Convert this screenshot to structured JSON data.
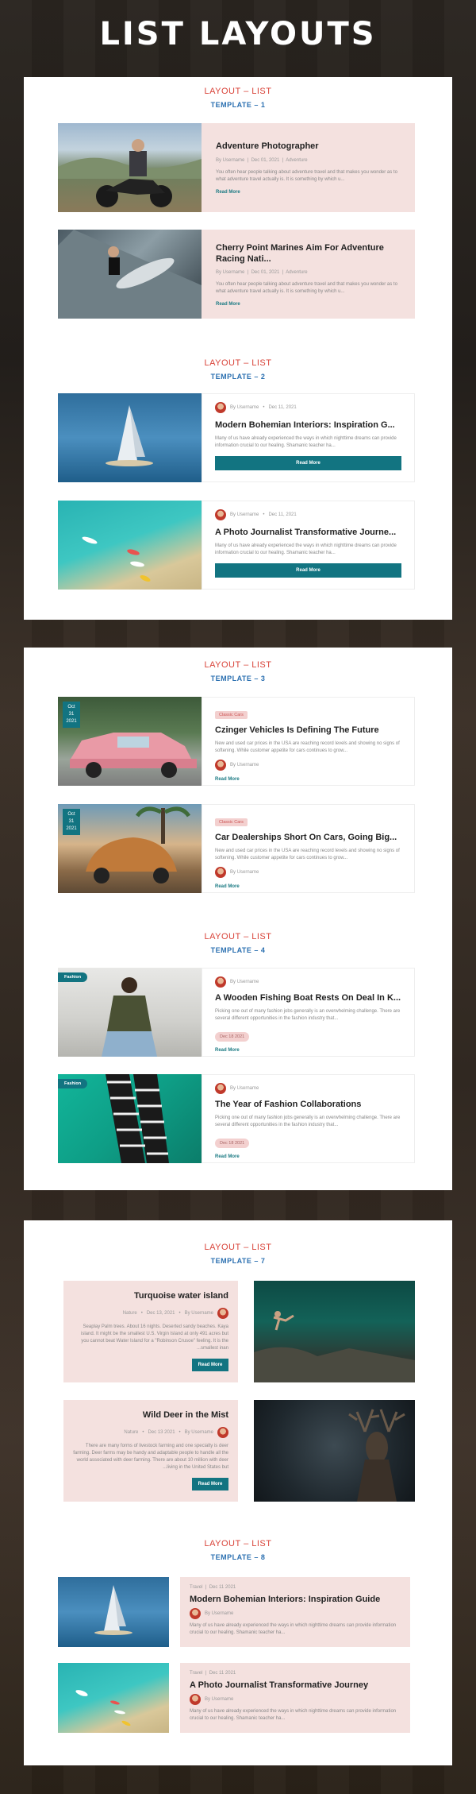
{
  "page_title": "LIST LAYOUTS",
  "sections": {
    "t1": {
      "layout": "LAYOUT – LIST",
      "template": "TEMPLATE – 1",
      "posts": [
        {
          "title": "Adventure Photographer",
          "author": "By Username",
          "date": "Dec 01, 2021",
          "category": "Adventure",
          "excerpt": "You often hear people talking about adventure travel and that makes you wonder as to what adventure travel actually is. It is something by which u...",
          "read_more": "Read More"
        },
        {
          "title": "Cherry Point Marines Aim For Adventure Racing Nati...",
          "author": "By Username",
          "date": "Dec 01, 2021",
          "category": "Adventure",
          "excerpt": "You often hear people talking about adventure travel and that makes you wonder as to what adventure travel actually is. It is something by which u...",
          "read_more": "Read More"
        }
      ]
    },
    "t2": {
      "layout": "LAYOUT – LIST",
      "template": "TEMPLATE – 2",
      "posts": [
        {
          "author": "By Username",
          "date": "Dec 11, 2021",
          "title": "Modern Bohemian Interiors: Inspiration G...",
          "excerpt": "Many of us have already experienced the ways in which nighttime dreams can provide information crucial to our healing. Shamanic teacher ha...",
          "button": "Read More"
        },
        {
          "author": "By Username",
          "date": "Dec 11, 2021",
          "title": "A Photo Journalist Transformative Journe...",
          "excerpt": "Many of us have already experienced the ways in which nighttime dreams can provide information crucial to our healing. Shamanic teacher ha...",
          "button": "Read More"
        }
      ]
    },
    "t3": {
      "layout": "LAYOUT – LIST",
      "template": "TEMPLATE – 3",
      "posts": [
        {
          "date_month": "Oct",
          "date_day": "31",
          "date_year": "2021",
          "tag": "Classic Cars",
          "title": "Czinger Vehicles Is Defining The Future",
          "excerpt": "New and used car prices in the USA are reaching record levels and showing no signs of softening. While customer appetite for cars continues to grow...",
          "author": "By Username",
          "read_more": "Read More"
        },
        {
          "date_month": "Oct",
          "date_day": "31",
          "date_year": "2021",
          "tag": "Classic Cars",
          "title": "Car Dealerships Short On Cars, Going Big...",
          "excerpt": "New and used car prices in the USA are reaching record levels and showing no signs of softening. While customer appetite for cars continues to grow...",
          "author": "By Username",
          "read_more": "Read More"
        }
      ]
    },
    "t4": {
      "layout": "LAYOUT – LIST",
      "template": "TEMPLATE – 4",
      "posts": [
        {
          "badge": "Fashion",
          "author": "By Username",
          "title": "A Wooden Fishing Boat Rests On Deal In K...",
          "excerpt": "Picking one out of many fashion jobs generally is an overwhelming challenge. There are several different opportunities in the fashion industry that...",
          "date": "Dec 18 2021",
          "read_more": "Read More"
        },
        {
          "badge": "Fashion",
          "author": "By Username",
          "title": "The Year of Fashion Collaborations",
          "excerpt": "Picking one out of many fashion jobs generally is an overwhelming challenge. There are several different opportunities in the fashion industry that...",
          "date": "Dec 18 2021",
          "read_more": "Read More"
        }
      ]
    },
    "t7": {
      "layout": "LAYOUT – LIST",
      "template": "TEMPLATE – 7",
      "posts": [
        {
          "title": "Turquoise water island",
          "category": "Nature",
          "date": "Dec 13, 2021",
          "author": "By Username",
          "excerpt": "Seaplay Palm trees. About 16 nights. Deserted sandy beaches. Kaya island. It might be the smallest U.S. Virgin Island at only 491 acres but you cannot beat Water Island for a \"Robinson Crusoe\" feeling. It is the ...smallest inan",
          "button": "Read More"
        },
        {
          "title": "Wild Deer in the Mist",
          "category": "Nature",
          "date": "Dec 13 2021",
          "author": "By Username",
          "excerpt": "There are many forms of livestock farming and one specialty is deer farming. Deer farms may be handy and adaptable people to handle all the world associated with deer farming. There are about 10 million with deer ...living in the United States but",
          "button": "Read More"
        }
      ]
    },
    "t8": {
      "layout": "LAYOUT – LIST",
      "template": "TEMPLATE – 8",
      "posts": [
        {
          "category": "Travel",
          "date": "Dec 11 2021",
          "title": "Modern Bohemian Interiors: Inspiration Guide",
          "author": "By Username",
          "excerpt": "Many of us have already experienced the ways in which nighttime dreams can provide information crucial to our healing. Shamanic teacher ha..."
        },
        {
          "category": "Travel",
          "date": "Dec 11 2021",
          "title": "A Photo Journalist Transformative Journey",
          "author": "By Username",
          "excerpt": "Many of us have already experienced the ways in which nighttime dreams can provide information crucial to our healing. Shamanic teacher ha..."
        }
      ]
    }
  }
}
